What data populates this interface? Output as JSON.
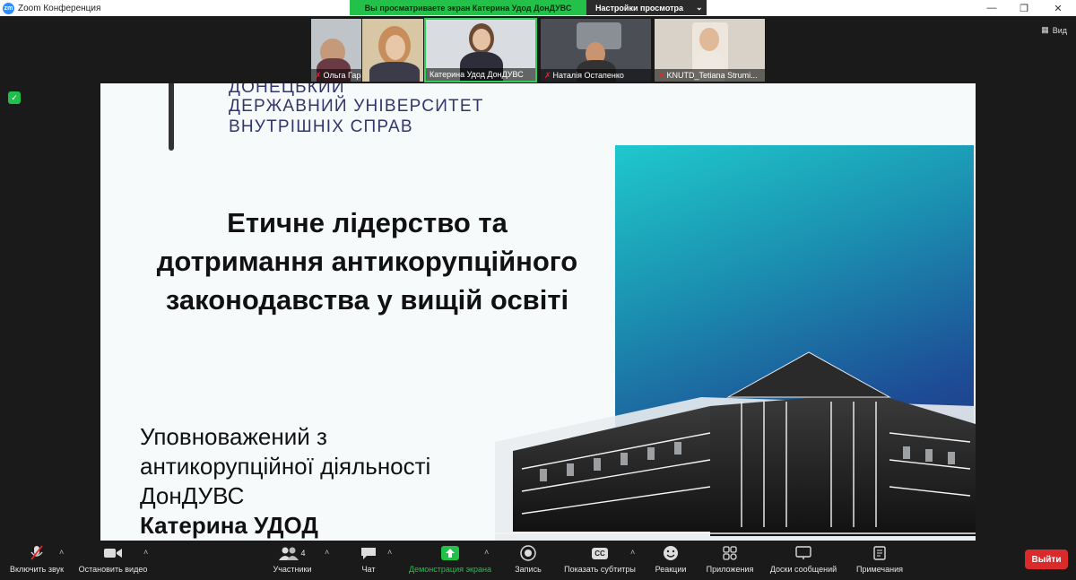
{
  "window": {
    "app_title": "Zoom Конференция",
    "logo_text": "zm",
    "share_banner": "Вы просматриваете экран Катерина Удод ДонДУВС",
    "view_settings": "Настройки просмотра",
    "view_label": "Вид"
  },
  "participants": [
    {
      "name": "Ольга Гаранiна",
      "muted": true,
      "active": false
    },
    {
      "name": "",
      "muted": false,
      "active": false
    },
    {
      "name": "Катерина Удод ДонДУВС",
      "muted": false,
      "active": true
    },
    {
      "name": "Наталiя Остапенко",
      "muted": true,
      "active": false
    },
    {
      "name": "KNUTD_Tetiana Strumi...",
      "muted": true,
      "active": false
    }
  ],
  "slide": {
    "university": [
      "ДОНЕЦЬКИЙ",
      "ДЕРЖАВНИЙ УНІВЕРСИТЕТ",
      "ВНУТРІШНІХ СПРАВ"
    ],
    "title": [
      "Етичне лідерство та",
      "дотримання антикорупційного",
      "законодавства у вищій освіті"
    ],
    "author_lines": [
      "Уповноважений з",
      "антикорупційної діяльності",
      "ДонДУВС"
    ],
    "author_name": "Катерина УДОД"
  },
  "toolbar": {
    "unmute": "Включить звук",
    "stop_video": "Остановить видео",
    "participants": "Участники",
    "participants_count": "4",
    "chat": "Чат",
    "share_screen": "Демонстрация экрана",
    "record": "Запись",
    "subtitles": "Показать субтитры",
    "cc": "CC",
    "reactions": "Реакции",
    "apps": "Приложения",
    "whiteboards": "Доски сообщений",
    "notes": "Примечания",
    "leave": "Выйти"
  },
  "colors": {
    "share_banner_bg": "#23c14a",
    "leave_bg": "#d92b2b",
    "share_icon": "#23c14a",
    "uni_text": "#33356d"
  },
  "icons": [
    "zoom-logo-icon",
    "minimize-icon",
    "maximize-icon",
    "close-icon",
    "grid-view-icon",
    "shield-icon",
    "mic-muted-icon",
    "video-icon",
    "participants-icon",
    "chat-icon",
    "share-screen-icon",
    "record-icon",
    "cc-icon",
    "reactions-icon",
    "apps-icon",
    "whiteboard-icon",
    "notes-icon"
  ]
}
